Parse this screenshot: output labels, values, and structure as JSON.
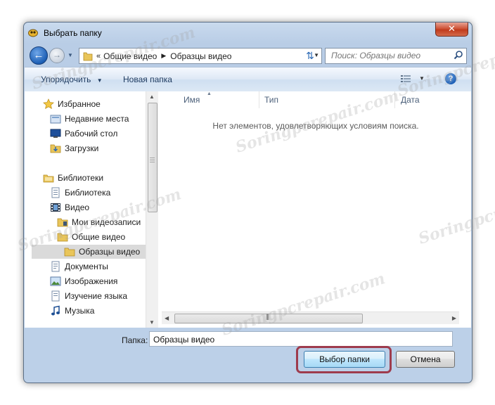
{
  "window": {
    "title": "Выбрать папку",
    "close_label": "✕"
  },
  "address_bar": {
    "prefix": "«",
    "crumbs": [
      "Общие видео",
      "Образцы видео"
    ]
  },
  "search": {
    "placeholder": "Поиск: Образцы видео"
  },
  "toolbar": {
    "organize_label": "Упорядочить",
    "new_folder_label": "Новая папка",
    "help_label": "?"
  },
  "nav_pane": {
    "items": [
      {
        "label": "Избранное",
        "icon": "star-icon"
      },
      {
        "label": "Недавние места",
        "icon": "recent-places-icon"
      },
      {
        "label": "Рабочий стол",
        "icon": "desktop-icon"
      },
      {
        "label": "Загрузки",
        "icon": "downloads-folder-icon"
      },
      {
        "label": "Библиотеки",
        "icon": "libraries-icon"
      },
      {
        "label": "Библиотека",
        "icon": "library-icon"
      },
      {
        "label": "Видео",
        "icon": "video-library-icon"
      },
      {
        "label": "Мои видеозаписи",
        "icon": "folder-icon"
      },
      {
        "label": "Общие видео",
        "icon": "folder-icon"
      },
      {
        "label": "Образцы видео",
        "icon": "folder-icon",
        "selected": true
      },
      {
        "label": "Документы",
        "icon": "documents-icon"
      },
      {
        "label": "Изображения",
        "icon": "pictures-icon"
      },
      {
        "label": "Изучение языка",
        "icon": "library-icon"
      },
      {
        "label": "Музыка",
        "icon": "music-icon"
      }
    ]
  },
  "file_list": {
    "columns": [
      "Имя",
      "Тип",
      "Дата"
    ],
    "empty_message": "Нет элементов, удовлетворяющих условиям поиска."
  },
  "footer": {
    "folder_label": "Папка:",
    "folder_value": "Образцы видео",
    "ok_label": "Выбор папки",
    "cancel_label": "Отмена"
  },
  "watermark": {
    "text": "Soringpcrepair.com"
  },
  "colors": {
    "highlight_border": "#9e3b4d",
    "close_button": "#c03a1c",
    "selected_row": "#dadada"
  }
}
